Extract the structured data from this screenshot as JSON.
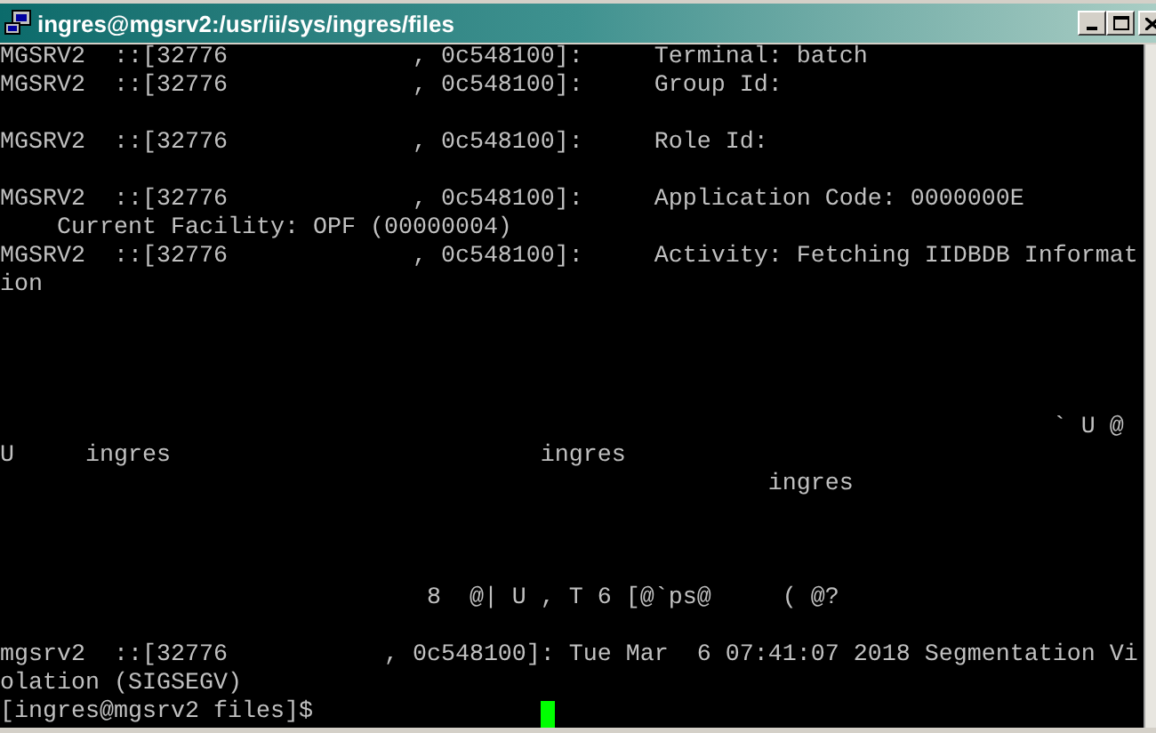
{
  "window": {
    "title": "ingres@mgsrv2:/usr/ii/sys/ingres/files"
  },
  "terminal": {
    "cursor_visible": true,
    "lines": [
      {
        "kind": "text",
        "text": "MGSRV2  ::[32776             , 0c548100]:     Terminal: batch"
      },
      {
        "kind": "text",
        "text": "MGSRV2  ::[32776             , 0c548100]:     Group Id:"
      },
      {
        "kind": "blank"
      },
      {
        "kind": "text",
        "text": "MGSRV2  ::[32776             , 0c548100]:     Role Id:"
      },
      {
        "kind": "blank"
      },
      {
        "kind": "text",
        "text": "MGSRV2  ::[32776             , 0c548100]:     Application Code: 0000000E"
      },
      {
        "kind": "text",
        "text": "    Current Facility: OPF (00000004)"
      },
      {
        "kind": "text",
        "text": "MGSRV2  ::[32776             , 0c548100]:     Activity: Fetching IIDBDB Informat"
      },
      {
        "kind": "text",
        "text": "ion"
      },
      {
        "kind": "blank"
      },
      {
        "kind": "blank"
      },
      {
        "kind": "blank"
      },
      {
        "kind": "blank"
      },
      {
        "kind": "text",
        "text": "                                                                          ` U @"
      },
      {
        "kind": "text",
        "text": "U     ingres                          ingres"
      },
      {
        "kind": "text",
        "text": "                                                      ingres"
      },
      {
        "kind": "blank"
      },
      {
        "kind": "blank"
      },
      {
        "kind": "blank"
      },
      {
        "kind": "text",
        "text": "                              8  @| U , T 6 [@`ps@     ( @?"
      },
      {
        "kind": "blank"
      },
      {
        "kind": "text",
        "text": "mgsrv2  ::[32776           , 0c548100]: Tue Mar  6 07:41:07 2018 Segmentation Vi"
      },
      {
        "kind": "text",
        "text": "olation (SIGSEGV)"
      },
      {
        "kind": "prompt",
        "text": "[ingres@mgsrv2 files]$"
      }
    ]
  }
}
